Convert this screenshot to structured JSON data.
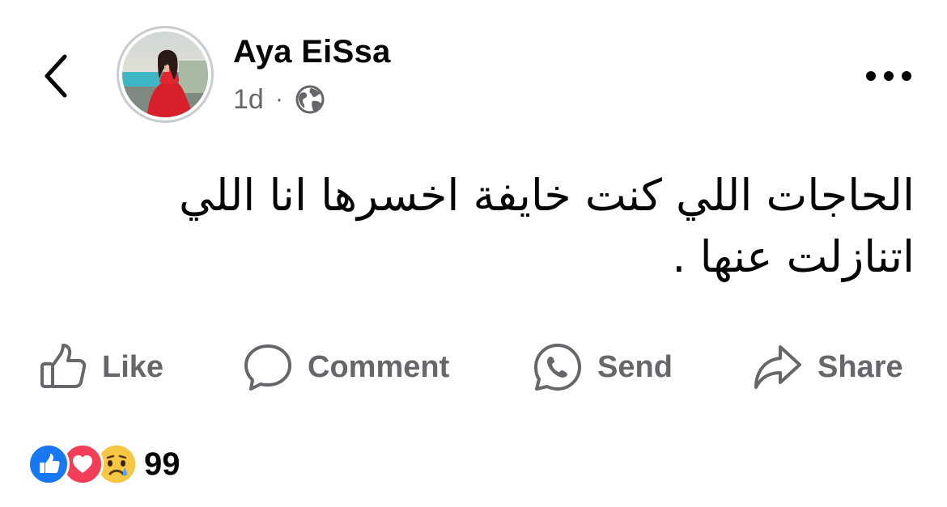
{
  "post": {
    "author_name": "Aya EiSsa",
    "time_ago": "1d",
    "separator": "·",
    "audience_icon": "globe-icon",
    "text": "الحاجات اللي كنت خايفة اخسرها انا اللي اتنازلت عنها ."
  },
  "actions": {
    "like_label": "Like",
    "comment_label": "Comment",
    "send_label": "Send",
    "share_label": "Share"
  },
  "reactions": {
    "types": [
      "like-reaction-icon",
      "love-reaction-icon",
      "sad-reaction-icon"
    ],
    "count": "99"
  },
  "colors": {
    "primary_text": "#050505",
    "secondary_text": "#65676b",
    "like_blue": "#1877f2",
    "love_red": "#f33e58",
    "sad_yellow": "#f7b928"
  }
}
